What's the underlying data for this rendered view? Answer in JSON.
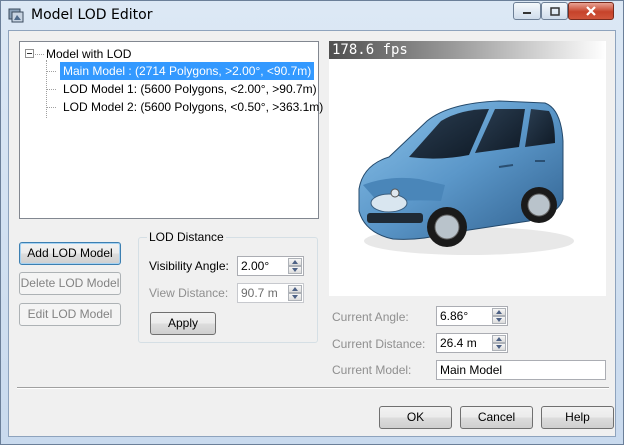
{
  "window": {
    "title": "Model LOD Editor"
  },
  "tree": {
    "root_label": "Model with LOD",
    "items": [
      {
        "label": "Main Model : (2714 Polygons, >2.00°, <90.7m)",
        "selected": true
      },
      {
        "label": "LOD Model 1: (5600 Polygons, <2.00°, >90.7m)",
        "selected": false
      },
      {
        "label": "LOD Model 2: (5600 Polygons, <0.50°, >363.1m)",
        "selected": false
      }
    ]
  },
  "viewport": {
    "fps": "178.6 fps"
  },
  "buttons": {
    "add_lod": "Add LOD Model",
    "delete_lod": "Delete LOD Model",
    "edit_lod": "Edit LOD Model",
    "apply": "Apply",
    "ok": "OK",
    "cancel": "Cancel",
    "help": "Help"
  },
  "lod_distance": {
    "group_label": "LOD Distance",
    "visibility_angle_label": "Visibility Angle:",
    "visibility_angle_value": "2.00°",
    "view_distance_label": "View Distance:",
    "view_distance_value": "90.7 m"
  },
  "current": {
    "angle_label": "Current Angle:",
    "angle_value": "6.86°",
    "distance_label": "Current Distance:",
    "distance_value": "26.4 m",
    "model_label": "Current Model:",
    "model_value": "Main Model"
  },
  "colors": {
    "selection": "#3399ff",
    "car_body": "#6aa6d6"
  }
}
